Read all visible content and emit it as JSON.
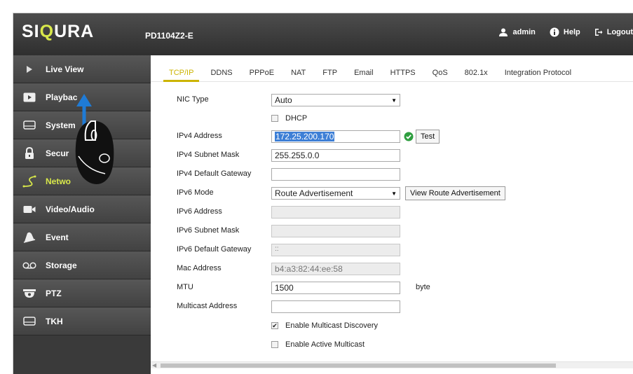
{
  "header": {
    "logo_a": "SI",
    "logo_q": "Q",
    "logo_b": "URA",
    "model": "PD1104Z2-E",
    "user": "admin",
    "help": "Help",
    "logout": "Logout"
  },
  "sidebar": {
    "items": [
      {
        "label": "Live View",
        "icon": "play-triangle-icon"
      },
      {
        "label": "Playback",
        "icon": "playback-icon"
      },
      {
        "label": "System",
        "icon": "monitor-icon"
      },
      {
        "label": "Security",
        "icon": "lock-icon"
      },
      {
        "label": "Network",
        "icon": "network-icon",
        "active": true
      },
      {
        "label": "Video/Audio",
        "icon": "camera-icon"
      },
      {
        "label": "Event",
        "icon": "event-icon"
      },
      {
        "label": "Storage",
        "icon": "storage-icon"
      },
      {
        "label": "PTZ",
        "icon": "ptz-icon"
      },
      {
        "label": "TKH",
        "icon": "monitor-icon"
      }
    ],
    "visible_text": [
      "Live View",
      "Playbac",
      "System",
      "Secur",
      "Netwo",
      "Video/Audio",
      "Event",
      "Storage",
      "PTZ",
      "TKH"
    ]
  },
  "tabs": [
    "TCP/IP",
    "DDNS",
    "PPPoE",
    "NAT",
    "FTP",
    "Email",
    "HTTPS",
    "QoS",
    "802.1x",
    "Integration Protocol"
  ],
  "active_tab": "TCP/IP",
  "form": {
    "nic_type_label": "NIC Type",
    "nic_type_value": "Auto",
    "dhcp_label": "DHCP",
    "ipv4_address_label": "IPv4 Address",
    "ipv4_address_value": "172.25.200.170",
    "test_label": "Test",
    "ipv4_mask_label": "IPv4 Subnet Mask",
    "ipv4_mask_value": "255.255.0.0",
    "ipv4_gw_label": "IPv4 Default Gateway",
    "ipv4_gw_value": "",
    "ipv6_mode_label": "IPv6 Mode",
    "ipv6_mode_value": "Route Advertisement",
    "view_route_label": "View Route Advertisement",
    "ipv6_address_label": "IPv6 Address",
    "ipv6_mask_label": "IPv6 Subnet Mask",
    "ipv6_gw_label": "IPv6 Default Gateway",
    "ipv6_gw_value": "::",
    "mac_label": "Mac Address",
    "mac_value": "b4:a3:82:44:ee:58",
    "mtu_label": "MTU",
    "mtu_value": "1500",
    "mtu_unit": "byte",
    "multicast_label": "Multicast Address",
    "multicast_value": "",
    "multicast_discovery_label": "Enable Multicast Discovery",
    "multicast_discovery_checked": true,
    "active_multicast_label": "Enable Active Multicast",
    "active_multicast_checked": false
  },
  "colors": {
    "accent": "#ccb400",
    "nav_active": "#d8e84a",
    "selection": "#3d7fd6",
    "ok_green": "#2e9e3f"
  }
}
